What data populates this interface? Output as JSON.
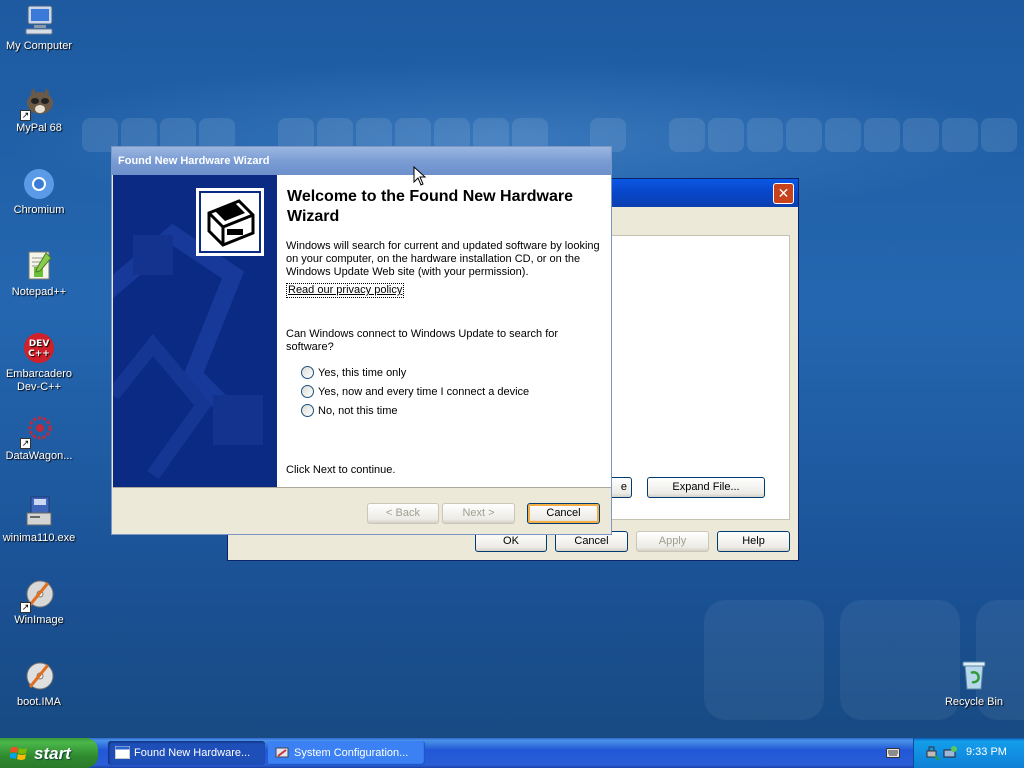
{
  "desktop": {
    "icons": [
      {
        "label": "My Computer"
      },
      {
        "label": "MyPal 68"
      },
      {
        "label": "Chromium"
      },
      {
        "label": "Notepad++"
      },
      {
        "label": "Embarcadero Dev-C++"
      },
      {
        "label": "DataWagon..."
      },
      {
        "label": "winima110.exe"
      },
      {
        "label": "WinImage"
      },
      {
        "label": "boot.IMA"
      },
      {
        "label": "Recycle Bin"
      }
    ]
  },
  "background_dialog": {
    "close_icon": "close-icon",
    "buttons": {
      "partial_label": "e",
      "expand_file": "Expand File...",
      "ok": "OK",
      "cancel": "Cancel",
      "apply": "Apply",
      "help": "Help"
    }
  },
  "wizard": {
    "window_title": "Found New Hardware Wizard",
    "heading": "Welcome to the Found New Hardware Wizard",
    "intro": "Windows will search for current and updated software by looking on your computer, on the hardware installation CD, or on the Windows Update Web site (with your permission).",
    "privacy_link": "Read our privacy policy",
    "question": "Can Windows connect to Windows Update to search for software?",
    "options": [
      {
        "label": "Yes, this time only"
      },
      {
        "label": "Yes, now and every time I connect a device"
      },
      {
        "label": "No, not this time"
      }
    ],
    "continue_text": "Click Next to continue.",
    "buttons": {
      "back": "< Back",
      "next": "Next >",
      "cancel": "Cancel"
    },
    "icon": "hardware-icon"
  },
  "taskbar": {
    "start_label": "start",
    "tasks": [
      {
        "label": "Found New Hardware...",
        "active": true
      },
      {
        "label": "System Configuration...",
        "active": false
      }
    ],
    "clock": "9:33 PM"
  }
}
